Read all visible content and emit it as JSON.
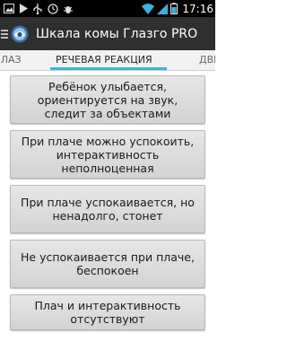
{
  "status_bar": {
    "time": "17:16"
  },
  "app_bar": {
    "title": "Шкала комы Глазго PRO"
  },
  "tabs": [
    {
      "label": "ГЛАЗ"
    },
    {
      "label": "РЕЧЕВАЯ РЕАКЦИЯ",
      "selected": true
    },
    {
      "label": "ДВИГ"
    }
  ],
  "options": [
    {
      "label": "Ребёнок улыбается, ориентируется на звук, следит за объектами"
    },
    {
      "label": "При плаче можно успокоить, интерактивность неполноценная"
    },
    {
      "label": "При плаче успокаивается, но ненадолго, стонет"
    },
    {
      "label": "Не успокаивается при плаче, беспокоен"
    },
    {
      "label": "Плач и интерактивность отсутствуют"
    }
  ],
  "colors": {
    "tab_indicator": "#33b5e5",
    "action_bar": "#2f2f2f",
    "status_bar": "#000000"
  }
}
